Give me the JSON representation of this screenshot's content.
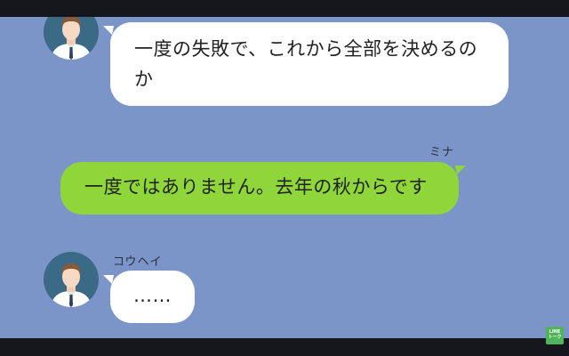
{
  "messages": [
    {
      "sender": "",
      "side": "left",
      "text_line1": "一度の失敗で、これから全部を決めるの",
      "text_line2": "か"
    },
    {
      "sender": "ミナ",
      "side": "right",
      "text": "一度ではありません。去年の秋からです"
    },
    {
      "sender": "コウヘイ",
      "side": "left",
      "text": "……"
    }
  ],
  "watermark": {
    "line1": "LINE",
    "line2": "トーク"
  },
  "colors": {
    "chat_background": "#7b95c9",
    "incoming_bubble": "#ffffff",
    "outgoing_bubble": "#8fd63a",
    "letterbox": "#15171d"
  },
  "icons": {
    "avatar": "man-avatar-icon",
    "watermark": "line-logo-icon"
  }
}
